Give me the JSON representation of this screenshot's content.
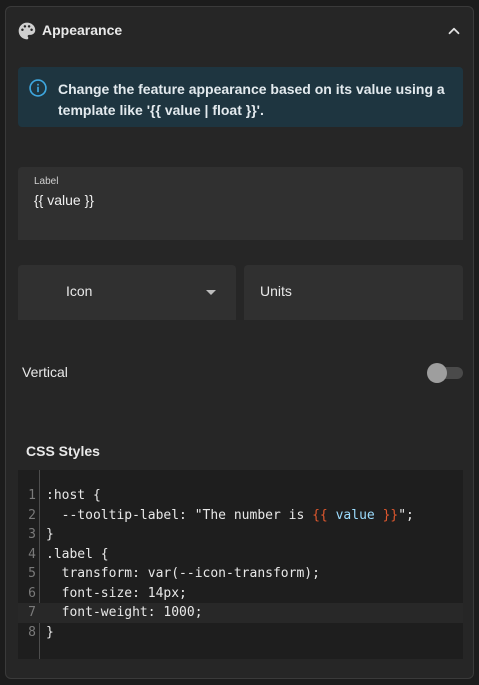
{
  "header": {
    "title": "Appearance",
    "icon": "palette-icon",
    "collapse_icon": "chevron-up-icon"
  },
  "info": {
    "text": "Change the feature appearance based on its value using a template like '{{ value | float }}'."
  },
  "label_field": {
    "label": "Label",
    "value": "{{ value }}"
  },
  "icon_field": {
    "label": "Icon"
  },
  "units_field": {
    "label": "Units"
  },
  "vertical": {
    "label": "Vertical",
    "enabled": false
  },
  "css": {
    "title": "CSS Styles",
    "lines": [
      {
        "n": "1",
        "code": ":host {"
      },
      {
        "n": "2",
        "pre": "  --tooltip-label: \"The number is ",
        "t1": "{{",
        "v": " value ",
        "t2": "}}",
        "post": "\";"
      },
      {
        "n": "3",
        "code": "}"
      },
      {
        "n": "4",
        "code": ".label {"
      },
      {
        "n": "5",
        "code": "  transform: var(--icon-transform);"
      },
      {
        "n": "6",
        "code": "  font-size: 14px;"
      },
      {
        "n": "7",
        "code": "  font-weight: 1000;"
      },
      {
        "n": "8",
        "code": "}"
      }
    ]
  },
  "colors": {
    "info_background": "#1e3540",
    "info_icon": "#3ea6de",
    "template_brace": "#e0582e"
  }
}
